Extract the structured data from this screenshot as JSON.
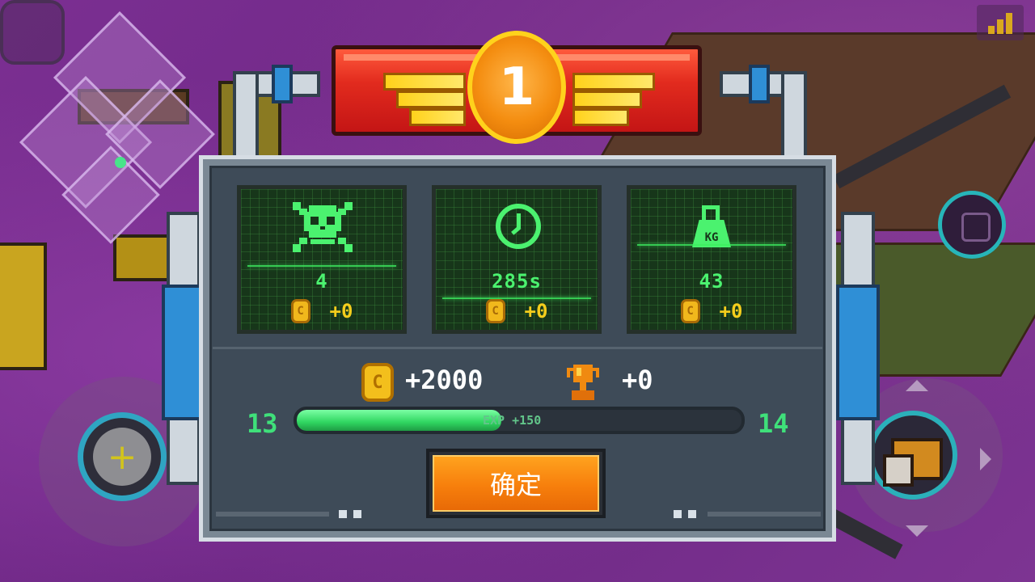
{
  "rank": "1",
  "stats": [
    {
      "icon": "skull-crossbones-icon",
      "value": "4",
      "coins": "+0"
    },
    {
      "icon": "clock-icon",
      "value": "285s",
      "coins": "+0"
    },
    {
      "icon": "kg-weight-icon",
      "value": "43",
      "coins": "+0",
      "icon_label": "KG"
    }
  ],
  "rewards": {
    "gold": "+2000",
    "trophy": "+0"
  },
  "level": {
    "current": "13",
    "next": "14",
    "exp_label": "EXP +150",
    "progress": 0.46
  },
  "confirm_label": "确定",
  "coin_glyph": "C",
  "colors": {
    "accent_green": "#4bf26f",
    "gold": "#f4cd1c",
    "button_orange": "#f77f0c",
    "banner_red": "#e22b1e"
  }
}
